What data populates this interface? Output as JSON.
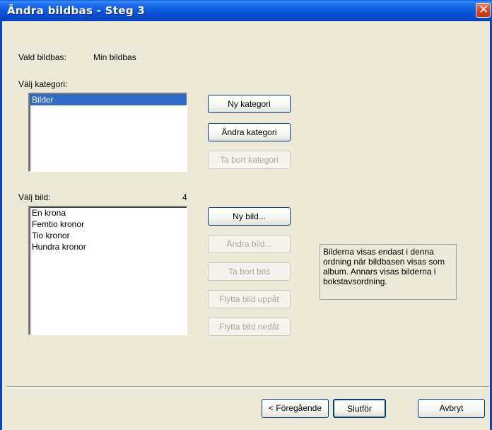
{
  "window": {
    "title": "Ändra bildbas - Steg 3"
  },
  "selected_db": {
    "label": "Vald bildbas:",
    "value": "Min bildbas"
  },
  "category": {
    "label": "Välj kategori:",
    "items": [
      "Bilder"
    ],
    "buttons": {
      "new": "Ny kategori",
      "edit": "Ändra kategori",
      "delete": "Ta bort kategori"
    }
  },
  "image": {
    "label": "Välj bild:",
    "count": "4",
    "items": [
      "En krona",
      "Femtio kronor",
      "Tio kronor",
      "Hundra kronor"
    ],
    "buttons": {
      "new": "Ny bild...",
      "edit": "Ändra bild...",
      "delete": "Ta bort bild",
      "move_up": "Flytta bild uppåt",
      "move_down": "Flytta bild nedåt"
    }
  },
  "info_text": "Bilderna visas endast i denna ordning när bildbasen visas som album. Annars visas bilderna i bokstavsordning.",
  "footer": {
    "prev": "< Föregående",
    "finish": "Slutför",
    "cancel": "Avbryt"
  }
}
